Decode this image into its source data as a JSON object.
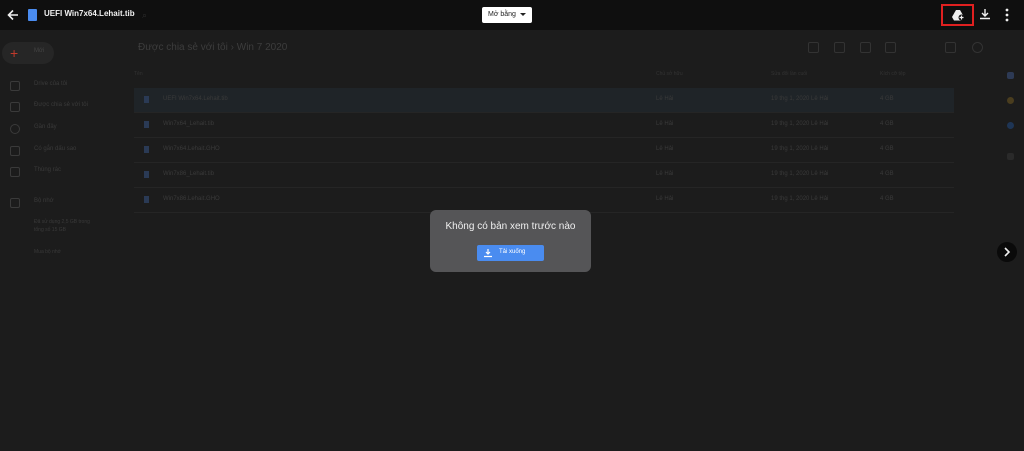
{
  "topbar": {
    "file_title": "UEFI Win7x64.Lehait.tib",
    "open_with_label": "Mở bằng",
    "icons": [
      "back-arrow-icon",
      "doc-file-icon",
      "add-to-drive-icon",
      "download-icon",
      "more-vert-icon"
    ]
  },
  "sidebar": {
    "new_label": "Mới",
    "items": [
      {
        "label": "Drive của tôi",
        "icon": "drive-icon"
      },
      {
        "label": "Được chia sẻ với tôi",
        "icon": "shared-icon"
      },
      {
        "label": "Gần đây",
        "icon": "clock-icon"
      },
      {
        "label": "Có gắn dấu sao",
        "icon": "star-icon"
      },
      {
        "label": "Thùng rác",
        "icon": "trash-icon"
      },
      {
        "label": "Bộ nhớ",
        "icon": "storage-icon"
      }
    ],
    "storage_used": "Đã sử dụng 2,5 GB trong",
    "storage_total": "tổng số 15 GB",
    "buy_storage": "Mua bộ nhớ"
  },
  "breadcrumb": {
    "root": "Được chia sẻ với tôi",
    "sep": "›",
    "folder": "Win 7 2020"
  },
  "table": {
    "columns": [
      "Tên",
      "Chủ sở hữu",
      "Sửa đổi lần cuối",
      "Kích cỡ tệp"
    ],
    "rows": [
      {
        "name": "UEFI Win7x64.Lehait.tib",
        "owner": "Lê Hải",
        "modified": "19 thg 1, 2020 Lê Hải",
        "size": "4 GB"
      },
      {
        "name": "Win7x64_Lehait.tib",
        "owner": "Lê Hải",
        "modified": "19 thg 1, 2020 Lê Hải",
        "size": "4 GB"
      },
      {
        "name": "Win7x64.Lehait.GHO",
        "owner": "Lê Hải",
        "modified": "19 thg 1, 2020 Lê Hải",
        "size": "4 GB"
      },
      {
        "name": "Win7x86_Lehait.tib",
        "owner": "Lê Hải",
        "modified": "19 thg 1, 2020 Lê Hải",
        "size": "4 GB"
      },
      {
        "name": "Win7x86.Lehait.GHO",
        "owner": "Lê Hải",
        "modified": "19 thg 1, 2020 Lê Hải",
        "size": "4 GB"
      }
    ]
  },
  "dialog": {
    "message": "Không có bản xem trước nào",
    "download_label": "Tải xuống"
  },
  "colors": {
    "accent": "#4a8cf0",
    "highlight": "#e02020",
    "dialog_bg": "#555557",
    "topbar_bg": "#0f0f0f"
  }
}
